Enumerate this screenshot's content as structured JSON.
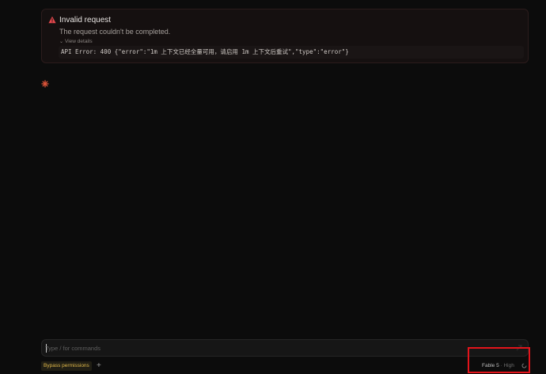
{
  "error": {
    "title": "Invalid request",
    "message": "The request couldn't be completed.",
    "details_toggle": "View details",
    "details": "API Error: 400 {\"error\":\"1m 上下文已经全量可用，请启用 1m 上下文后重试\",\"type\":\"error\"}"
  },
  "composer": {
    "placeholder": "Type / for commands",
    "value": ""
  },
  "footer": {
    "permission_mode": "Bypass permissions",
    "add_label": "+",
    "model_name": "Fable 5",
    "model_separator": " · ",
    "model_level": "High"
  },
  "colors": {
    "background": "#0c0c0c",
    "error_accent": "#e5484d",
    "spinner_accent": "#e0553a",
    "permission_accent": "#e0b84a",
    "highlight_box": "#e3141b"
  },
  "icons": {
    "error": "warning-triangle-icon",
    "working": "asterisk-spinner-icon",
    "send": "send-icon",
    "status": "spinner-icon"
  }
}
